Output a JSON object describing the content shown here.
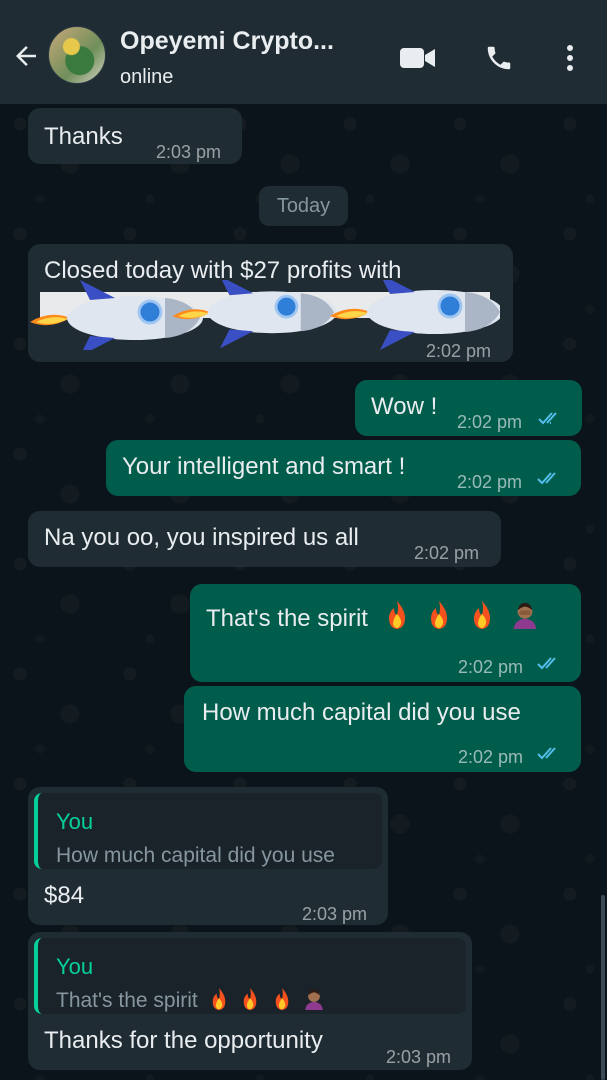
{
  "header": {
    "contact_name": "Opeyemi Crypto...",
    "status": "online",
    "icons": [
      "back-arrow-icon",
      "avatar",
      "video-call-icon",
      "phone-icon",
      "more-vert-icon"
    ]
  },
  "date_chip": "Today",
  "messages": [
    {
      "id": "m0",
      "dir": "in",
      "text": "Thanks",
      "time": "2:03 pm"
    },
    {
      "id": "m1",
      "dir": "in",
      "text": "Closed today with $27 profits with",
      "time": "2:02 pm",
      "sticker": "rocket-emojis"
    },
    {
      "id": "m2",
      "dir": "out",
      "text": "Wow !",
      "time": "2:02 pm",
      "read": true
    },
    {
      "id": "m3",
      "dir": "out",
      "text": "Your intelligent and smart !",
      "time": "2:02 pm",
      "read": true
    },
    {
      "id": "m4",
      "dir": "in",
      "text": "Na you oo, you inspired us all",
      "time": "2:02 pm"
    },
    {
      "id": "m5",
      "dir": "out",
      "text": "That's the spirit",
      "emojis": [
        "fire",
        "fire",
        "fire",
        "person-facepalming"
      ],
      "time": "2:02 pm",
      "read": true
    },
    {
      "id": "m6",
      "dir": "out",
      "text": "How much capital did you use",
      "time": "2:02 pm",
      "read": true
    },
    {
      "id": "m7",
      "dir": "in",
      "quote_name": "You",
      "quote_text": "How much capital did you use",
      "text": "$84",
      "time": "2:03 pm"
    },
    {
      "id": "m8",
      "dir": "in",
      "quote_name": "You",
      "quote_text": "That's the spirit",
      "text": "Thanks for the opportunity",
      "time": "2:03 pm"
    }
  ],
  "colors": {
    "header_bg": "#1f2c34",
    "chat_bg": "#0b141a",
    "incoming_bubble": "#1f2c34",
    "outgoing_bubble": "#005c4b",
    "read_ticks": "#53bdeb",
    "quote_accent": "#06cf9c"
  }
}
